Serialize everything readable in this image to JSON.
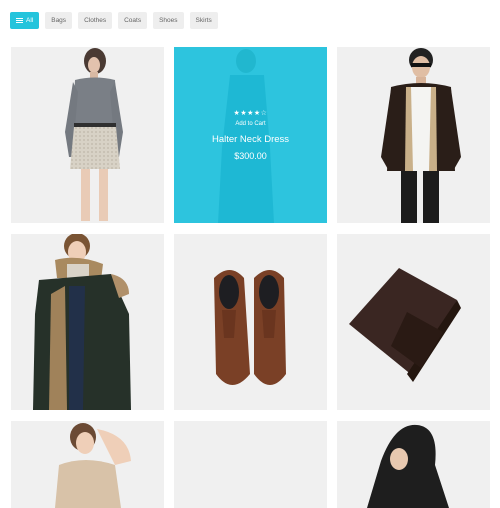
{
  "filters": [
    {
      "label": "All",
      "active": true
    },
    {
      "label": "Bags"
    },
    {
      "label": "Clothes"
    },
    {
      "label": "Coats"
    },
    {
      "label": "Shoes"
    },
    {
      "label": "Skirts"
    }
  ],
  "featured": {
    "stars": "★★★★☆",
    "add_to_cart": "Add to Cart",
    "name": "Halter Neck Dress",
    "price": "$300.00"
  },
  "colors": {
    "accent": "#24c4dc",
    "tile_bg": "#f0f0f0"
  }
}
